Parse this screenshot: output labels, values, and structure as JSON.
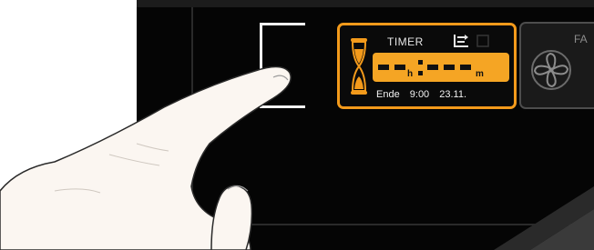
{
  "timer": {
    "title": "TIMER",
    "hours_unit": "h",
    "minutes_unit": "m",
    "end_label": "Ende",
    "end_time": "9:00",
    "end_date": "23.11."
  },
  "fan": {
    "label": "FA"
  },
  "colors": {
    "accent": "#f39a1b",
    "display": "#f5a524",
    "screen": "#050505"
  },
  "icons": [
    "hourglass-icon",
    "program-list-icon",
    "fan-icon",
    "touch-hand-graphic"
  ]
}
